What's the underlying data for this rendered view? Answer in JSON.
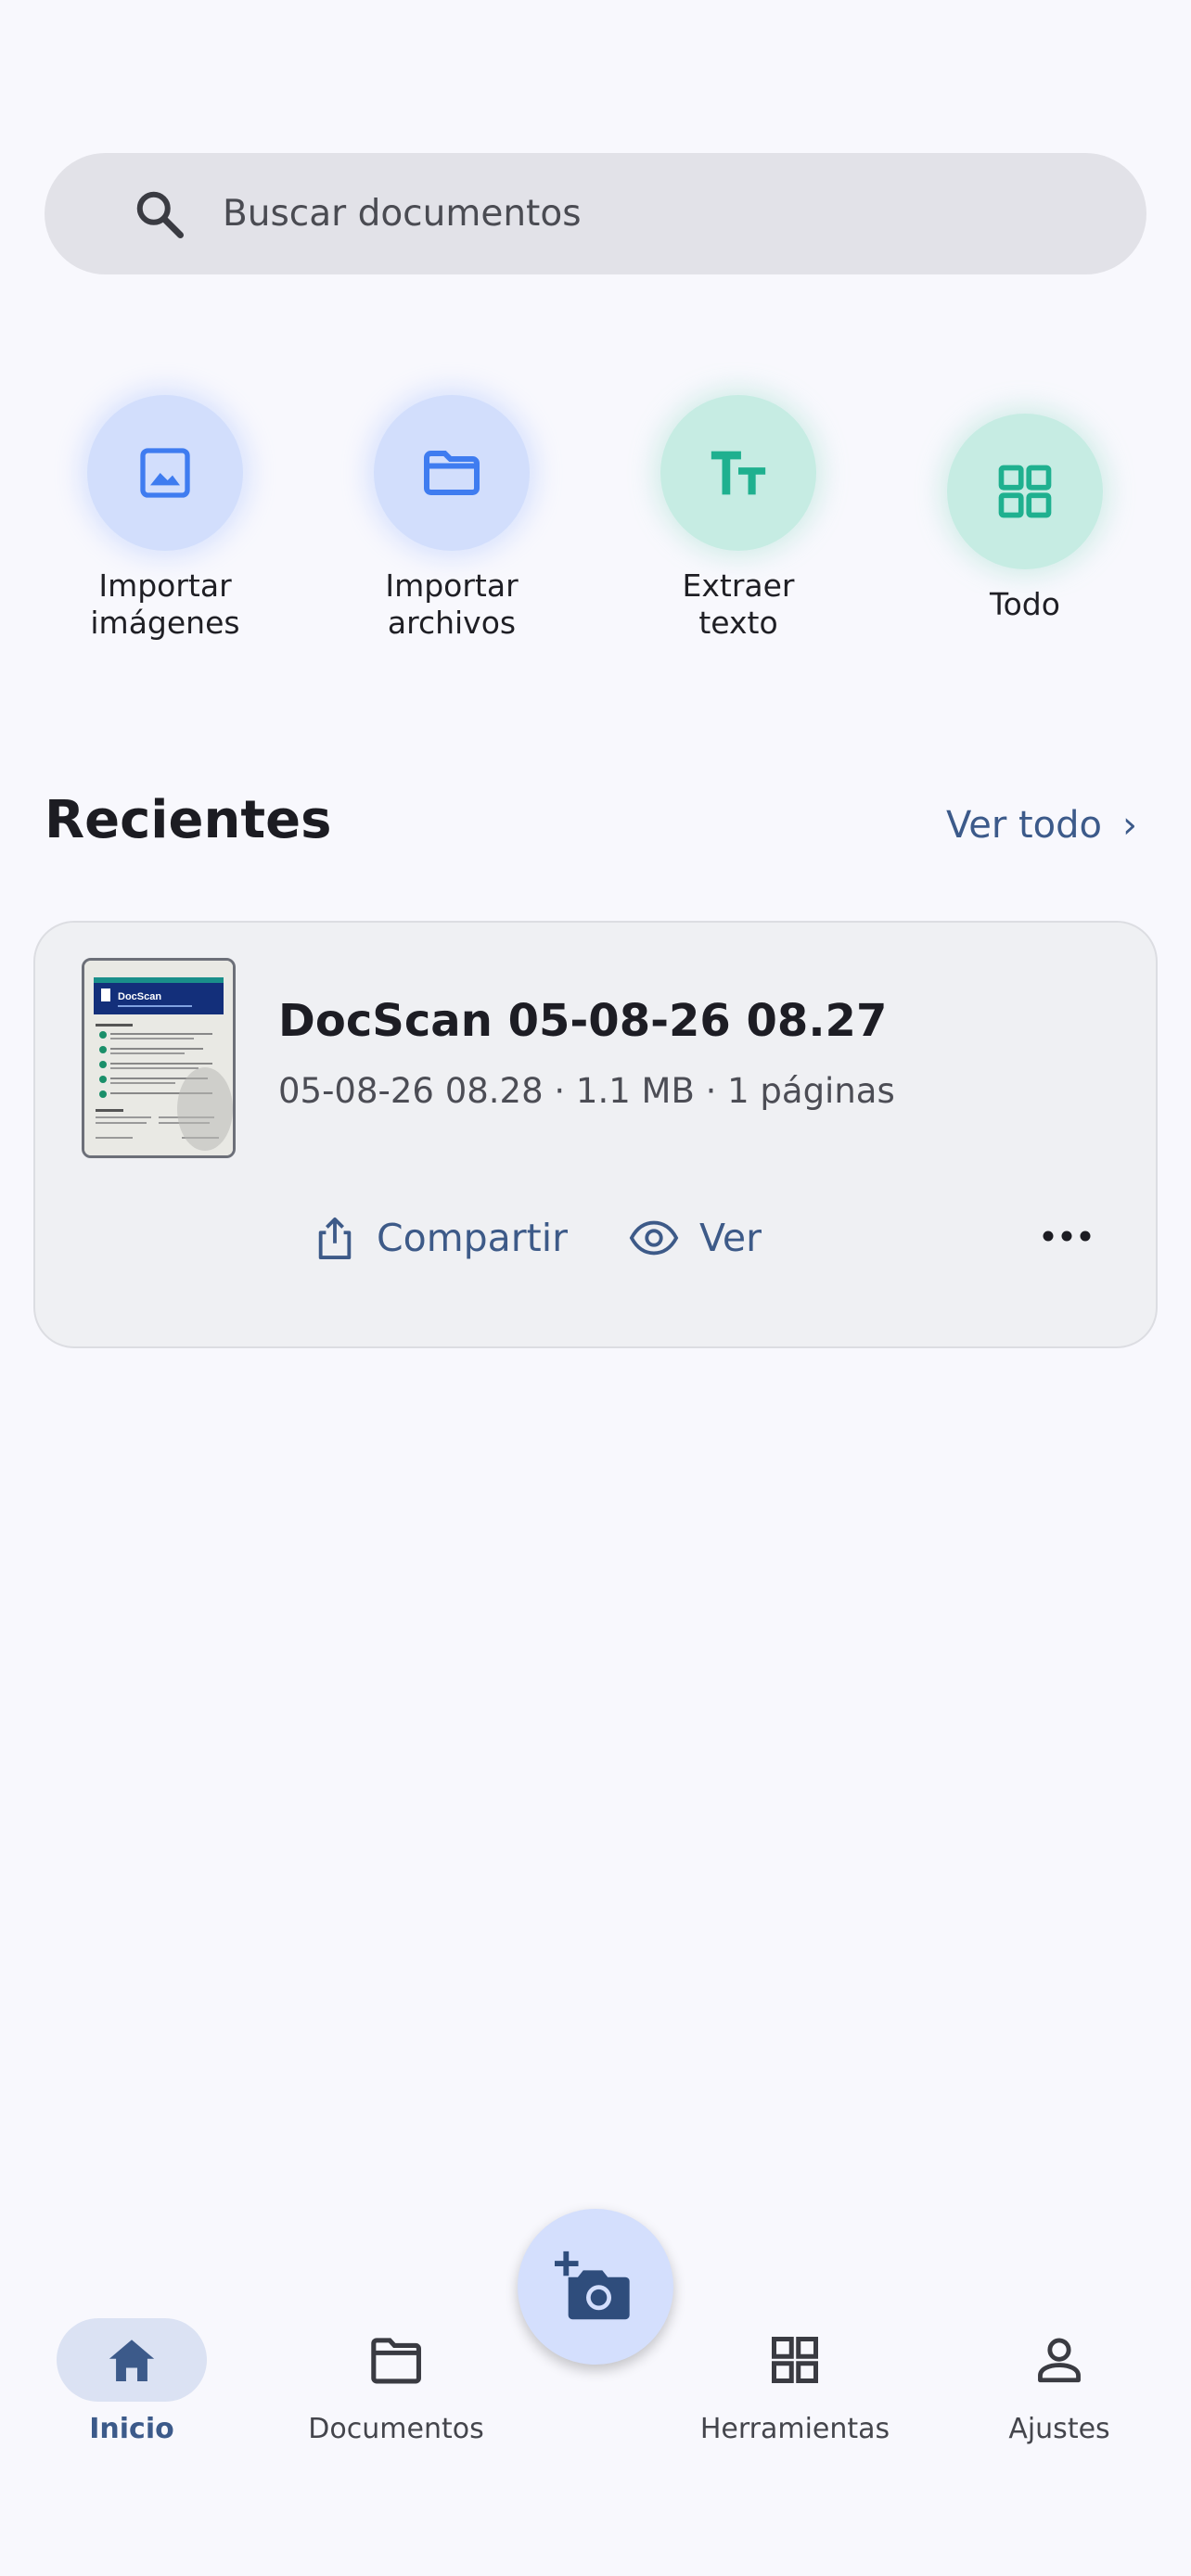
{
  "search": {
    "placeholder": "Buscar documentos"
  },
  "quick_actions": [
    {
      "label": "Importar\nimágenes",
      "icon": "image-icon"
    },
    {
      "label": "Importar\narchivos",
      "icon": "folder-icon"
    },
    {
      "label": "Extraer\ntexto",
      "icon": "text-tt-icon"
    },
    {
      "label": "Todo",
      "icon": "grid-icon"
    }
  ],
  "recent": {
    "title": "Recientes",
    "see_all": "Ver todo",
    "see_all_chevron": "›",
    "item": {
      "name": "DocScan 05-08-26 08.27",
      "meta": "05-08-26 08.28 · 1.1 MB · 1 páginas",
      "share_label": "Compartir",
      "view_label": "Ver",
      "thumb_brand": "DocScan"
    }
  },
  "fab": {
    "icon": "add-camera-icon"
  },
  "nav": [
    {
      "label": "Inicio",
      "icon": "home-icon",
      "active": true
    },
    {
      "label": "Documentos",
      "icon": "folder-outline-icon",
      "active": false
    },
    {
      "label": "Herramientas",
      "icon": "grid-outline-icon",
      "active": false
    },
    {
      "label": "Ajustes",
      "icon": "person-icon",
      "active": false
    }
  ],
  "colors": {
    "background": "#f8f8fd",
    "accent": "#3c5a8a",
    "blue_icon": "#3f7cf0",
    "teal_icon": "#1fb08f"
  }
}
